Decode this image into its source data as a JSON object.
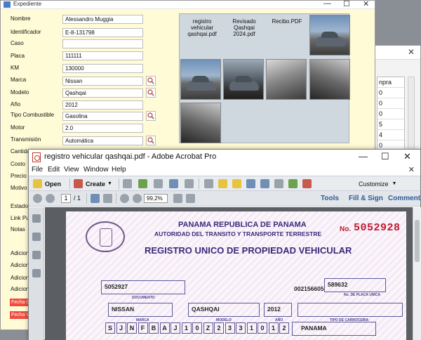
{
  "form": {
    "title": "Expediente",
    "fields": [
      {
        "label": "Nombre",
        "value": "Alessandro Muggia"
      },
      {
        "label": "Identificador",
        "value": "E-8-131798"
      },
      {
        "label": "Caso",
        "value": ""
      },
      {
        "label": "Placa",
        "value": "111111"
      },
      {
        "label": "KM",
        "value": "130000"
      },
      {
        "label": "Marca",
        "value": "Nissan"
      },
      {
        "label": "Modelo",
        "value": "Qashqai"
      },
      {
        "label": "Año",
        "value": "2012"
      },
      {
        "label": "Tipo Combustible",
        "value": "Gasolina"
      },
      {
        "label": "Motor",
        "value": "2.0"
      },
      {
        "label": "Transmisión",
        "value": "Automática"
      }
    ],
    "more_labels": [
      "Cantidad de P",
      "Costo",
      "Precio",
      "Motivo de",
      "Estado",
      "Link Publ",
      "Notas",
      "Adicional",
      "Adicional",
      "Adicional",
      "Adicional"
    ],
    "red_labels": [
      "Fecha C",
      "Fecha V"
    ],
    "documents": [
      "registro vehicular qashqai.pdf",
      "Revisado Qashqai 2024.pdf",
      "Recibo.PDF"
    ]
  },
  "bgwin": {
    "header": "npra",
    "cells": [
      "0",
      "0",
      "0",
      "5",
      "4",
      "0",
      "0",
      "0"
    ]
  },
  "acrobat": {
    "title": "registro vehicular qashqai.pdf - Adobe Acrobat Pro",
    "menu": [
      "File",
      "Edit",
      "View",
      "Window",
      "Help"
    ],
    "toolbar": {
      "open": "Open",
      "create": "Create",
      "customize": "Customize"
    },
    "page_current": "1",
    "page_total": "/ 1",
    "zoom": "99,2%",
    "links": [
      "Tools",
      "Fill & Sign",
      "Comment"
    ]
  },
  "document": {
    "title1": "PANAMA REPUBLICA DE PANAMA",
    "title2": "AUTORIDAD DEL TRANSITO Y TRANSPORTE TERRESTRE",
    "title3": "REGISTRO UNICO DE PROPIEDAD VEHICULAR",
    "no_label": "No.",
    "reg_number": "5052928",
    "documento": "5052927",
    "documento_label": "DOCUMENTO",
    "plate_prefix": "002156605",
    "plate": "589632",
    "plate_label": "No. DE PLACA UNICA",
    "marca": "NISSAN",
    "marca_label": "MARCA",
    "modelo": "QASHQAI",
    "modelo_label": "MODELO",
    "anio": "2012",
    "anio_label": "AÑO",
    "carroceria_label": "TIPO DE CARROCERIA",
    "vin": [
      "S",
      "J",
      "N",
      "F",
      "B",
      "A",
      "J",
      "1",
      "0",
      "Z",
      "2",
      "3",
      "3",
      "1",
      "0",
      "1",
      "2"
    ],
    "pais": "PANAMA"
  },
  "colors": {
    "form_bg": "#fffbd6",
    "doc_panel": "#cfd7df",
    "reg_red": "#c0182d",
    "ink": "#3a2a78",
    "link_blue": "#2e5b96"
  }
}
